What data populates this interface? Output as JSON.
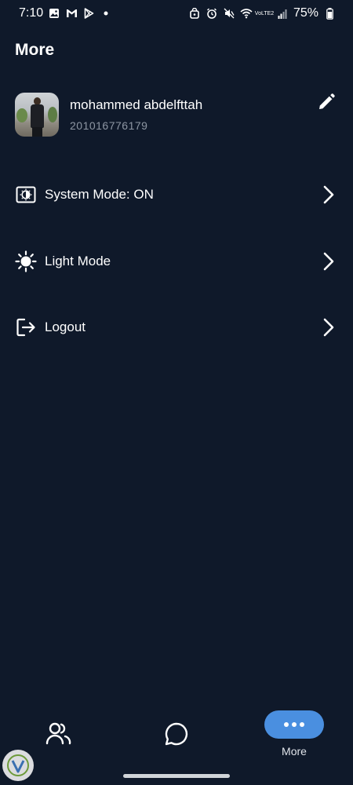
{
  "status_bar": {
    "time": "7:10",
    "left_icons": [
      "gallery-icon",
      "gmail-icon",
      "play-store-icon",
      "dot-icon"
    ],
    "right_icons": [
      "lock-icon",
      "alarm-icon",
      "mute-icon",
      "wifi-icon",
      "volte-icon",
      "signal-icon"
    ],
    "volte_text": "VoLTE2",
    "battery": "75%"
  },
  "page": {
    "title": "More"
  },
  "profile": {
    "name": "mohammed abdelfttah",
    "phone": "201016776179",
    "edit_icon": "pencil-icon"
  },
  "menu": {
    "items": [
      {
        "label": "System Mode: ON",
        "icon": "system-mode-icon"
      },
      {
        "label": "Light Mode",
        "icon": "sun-icon"
      },
      {
        "label": "Logout",
        "icon": "logout-icon"
      }
    ]
  },
  "bottom_nav": {
    "items": [
      {
        "icon": "people-icon",
        "label": ""
      },
      {
        "icon": "chat-icon",
        "label": ""
      },
      {
        "icon": "more-dots-icon",
        "label": "More"
      }
    ],
    "active_index": 2
  },
  "colors": {
    "background": "#0f192a",
    "accent": "#4a8fe0",
    "secondary_text": "#8d96a3"
  }
}
